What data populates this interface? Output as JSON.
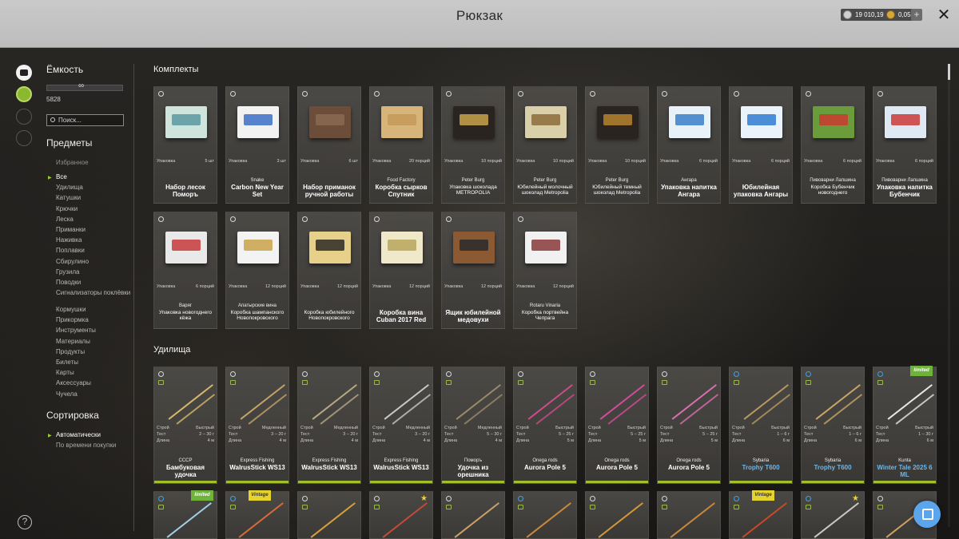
{
  "window": {
    "title": "Рюкзак",
    "currency_silver": "19 010,19",
    "currency_gold": "0,05",
    "plus_label": "+",
    "close_label": "✕"
  },
  "sidebar": {
    "capacity_heading": "Ёмкость",
    "capacity_infinity": "∞",
    "capacity_value": "5828",
    "search_placeholder": "Поиск...",
    "items_heading": "Предметы",
    "favorites_label": "Избранное",
    "categories": [
      "Все",
      "Удилища",
      "Катушки",
      "Крючки",
      "Леска",
      "Приманки",
      "Наживка",
      "Поплавки",
      "Сбирулино",
      "Грузила",
      "Поводки",
      "Сигнализаторы поклёвки",
      "Кормушки",
      "Прикормка",
      "Инструменты",
      "Материалы",
      "Продукты",
      "Билеты",
      "Карты",
      "Аксессуары",
      "Чучела"
    ],
    "sort_heading": "Сортировка",
    "sort_options": [
      "Автоматически",
      "По времени покупки"
    ],
    "help_label": "?"
  },
  "sections": {
    "sets_title": "Комплекты",
    "rods_title": "Удилища"
  },
  "sets": [
    {
      "pack": "Упаковка",
      "qty": "5 шт",
      "brand": "",
      "name": "Набор лесок Поморъ",
      "small": false
    },
    {
      "pack": "Упаковка",
      "qty": "3 шт",
      "brand": "Snake",
      "name": "Carbon New Year Set",
      "small": false
    },
    {
      "pack": "Упаковка",
      "qty": "6 шт",
      "brand": "",
      "name": "Набор приманок ручной работы",
      "small": false
    },
    {
      "pack": "Упаковка",
      "qty": "20 порций",
      "brand": "Food Factory",
      "name": "Коробка сырков Спутник",
      "small": false
    },
    {
      "pack": "Упаковка",
      "qty": "10 порций",
      "brand": "Peter Burg",
      "name": "Упаковка шоколада METROPOLIA",
      "small": true
    },
    {
      "pack": "Упаковка",
      "qty": "10 порций",
      "brand": "Peter Burg",
      "name": "Юбилейный молочный шоколад Metropolia",
      "small": true
    },
    {
      "pack": "Упаковка",
      "qty": "10 порций",
      "brand": "Peter Burg",
      "name": "Юбилейный темный шоколад Metropolia",
      "small": true
    },
    {
      "pack": "Упаковка",
      "qty": "6 порций",
      "brand": "Ангара",
      "name": "Упаковка напитка Ангара",
      "small": false
    },
    {
      "pack": "Упаковка",
      "qty": "6 порций",
      "brand": "",
      "name": "Юбилейная упаковка Ангары",
      "small": false
    },
    {
      "pack": "Упаковка",
      "qty": "6 порций",
      "brand": "Пивоварни Лапшина",
      "name": "Коробка Бубенчик новогоднего",
      "small": true
    },
    {
      "pack": "Упаковка",
      "qty": "6 порций",
      "brand": "Пивоварни Лапшина",
      "name": "Упаковка напитка Бубенчик",
      "small": false
    },
    {
      "pack": "Упаковка",
      "qty": "6 порций",
      "brand": "Варяг",
      "name": "Упаковка новогоднего кёжа",
      "small": true
    },
    {
      "pack": "Упаковка",
      "qty": "12 порций",
      "brand": "Апатырские вина",
      "name": "Коробка шампанского Новопокровского",
      "small": true
    },
    {
      "pack": "Упаковка",
      "qty": "12 порций",
      "brand": "",
      "name": "Коробка юбилейного Новопокровского",
      "small": true
    },
    {
      "pack": "Упаковка",
      "qty": "12 порций",
      "brand": "",
      "name": "Коробка вина Cuban 2017 Red",
      "small": false
    },
    {
      "pack": "Упаковка",
      "qty": "12 порций",
      "brand": "",
      "name": "Ящик юбилейной медовухи",
      "small": false
    },
    {
      "pack": "Упаковка",
      "qty": "12 порций",
      "brand": "Rotaru Vinaria",
      "name": "Коробка портвейна Чепрага",
      "small": true
    }
  ],
  "rods": [
    {
      "build_label": "Строй",
      "build": "Быстрый",
      "test_label": "Тест",
      "test": "2 – 30 г",
      "len_label": "Длина",
      "len": "4 м",
      "brand": "СССР",
      "name": "Бамбуковая удочка",
      "blue": false,
      "color": "#d8b66a"
    },
    {
      "build_label": "Строй",
      "build": "Медленный",
      "test_label": "Тест",
      "test": "3 – 20 г",
      "len_label": "Длина",
      "len": "4 м",
      "brand": "Express Fishing",
      "name": "WalrusStick WS13",
      "blue": false,
      "color": "#c4a36a"
    },
    {
      "build_label": "Строй",
      "build": "Медленный",
      "test_label": "Тест",
      "test": "3 – 20 г",
      "len_label": "Длина",
      "len": "4 м",
      "brand": "Express Fishing",
      "name": "WalrusStick WS13",
      "blue": false,
      "color": "#b9a884"
    },
    {
      "build_label": "Строй",
      "build": "Медленный",
      "test_label": "Тест",
      "test": "3 – 20 г",
      "len_label": "Длина",
      "len": "4 м",
      "brand": "Express Fishing",
      "name": "WalrusStick WS13",
      "blue": false,
      "color": "#c8c8c8"
    },
    {
      "build_label": "Строй",
      "build": "Медленный",
      "test_label": "Тест",
      "test": "5 – 30 г",
      "len_label": "Длина",
      "len": "4 м",
      "brand": "Поморъ",
      "name": "Удочка из орешника",
      "blue": false,
      "color": "#9b8a6a"
    },
    {
      "build_label": "Строй",
      "build": "Быстрый",
      "test_label": "Тест",
      "test": "5 – 25 г",
      "len_label": "Длина",
      "len": "5 м",
      "brand": "Onega rods",
      "name": "Aurora Pole 5",
      "blue": false,
      "color": "#d04a8a"
    },
    {
      "build_label": "Строй",
      "build": "Быстрый",
      "test_label": "Тест",
      "test": "5 – 25 г",
      "len_label": "Длина",
      "len": "5 м",
      "brand": "Onega rods",
      "name": "Aurora Pole 5",
      "blue": false,
      "color": "#d24c9b"
    },
    {
      "build_label": "Строй",
      "build": "Быстрый",
      "test_label": "Тест",
      "test": "5 – 25 г",
      "len_label": "Длина",
      "len": "5 м",
      "brand": "Onega rods",
      "name": "Aurora Pole 5",
      "blue": false,
      "color": "#d86fae"
    },
    {
      "build_label": "Строй",
      "build": "Быстрый",
      "test_label": "Тест",
      "test": "1 – 6 г",
      "len_label": "Длина",
      "len": "6 м",
      "brand": "Sybaria",
      "name": "Trophy T600",
      "blue": true,
      "color": "#b99960"
    },
    {
      "build_label": "Строй",
      "build": "Быстрый",
      "test_label": "Тест",
      "test": "1 – 6 г",
      "len_label": "Длина",
      "len": "6 м",
      "brand": "Sybaria",
      "name": "Trophy T600",
      "blue": true,
      "color": "#c9a667"
    },
    {
      "build_label": "Строй",
      "build": "Быстрый",
      "test_label": "Тест",
      "test": "1 – 30 г",
      "len_label": "Длина",
      "len": "6 м",
      "brand": "Kunta",
      "name": "Winter Tale 2025 6 ML",
      "blue": true,
      "color": "#e7e7e7"
    }
  ],
  "badges": {
    "limited": "limited",
    "vintage": "Vintage",
    "star": "★"
  }
}
